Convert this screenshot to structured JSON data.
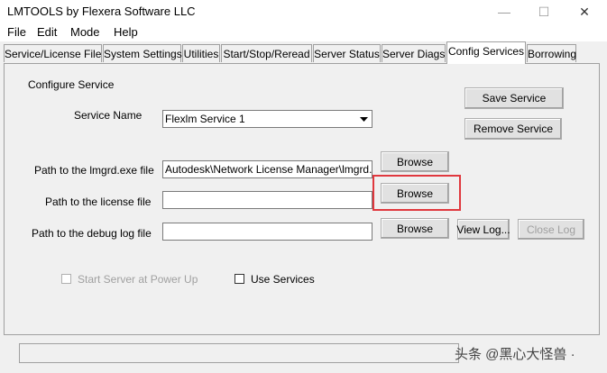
{
  "window": {
    "title": "LMTOOLS by Flexera Software LLC",
    "minimize": "—",
    "maximize": "☐",
    "close": "✕"
  },
  "menu": [
    "File",
    "Edit",
    "Mode",
    "Help"
  ],
  "tabs": [
    {
      "label": "Service/License File",
      "active": false
    },
    {
      "label": "System Settings",
      "active": false
    },
    {
      "label": "Utilities",
      "active": false
    },
    {
      "label": "Start/Stop/Reread",
      "active": false
    },
    {
      "label": "Server Status",
      "active": false
    },
    {
      "label": "Server Diags",
      "active": false
    },
    {
      "label": "Config Services",
      "active": true
    },
    {
      "label": "Borrowing",
      "active": false
    }
  ],
  "config": {
    "section_title": "Configure Service",
    "service_name_label": "Service Name",
    "service_name_value": "Flexlm Service 1",
    "save_service": "Save Service",
    "remove_service": "Remove Service",
    "lmgrd_label": "Path to the lmgrd.exe file",
    "lmgrd_value": "Autodesk\\Network License Manager\\lmgrd.exe",
    "license_label": "Path to the license file",
    "license_value": "",
    "debug_label": "Path to the debug log file",
    "debug_value": "",
    "browse": "Browse",
    "view_log": "View Log...",
    "close_log": "Close Log",
    "start_server_label": "Start Server at Power Up",
    "use_services_label": "Use Services"
  },
  "watermark": "头条 @黑心大怪兽 ·",
  "colors": {
    "highlight": "#e0383e"
  }
}
